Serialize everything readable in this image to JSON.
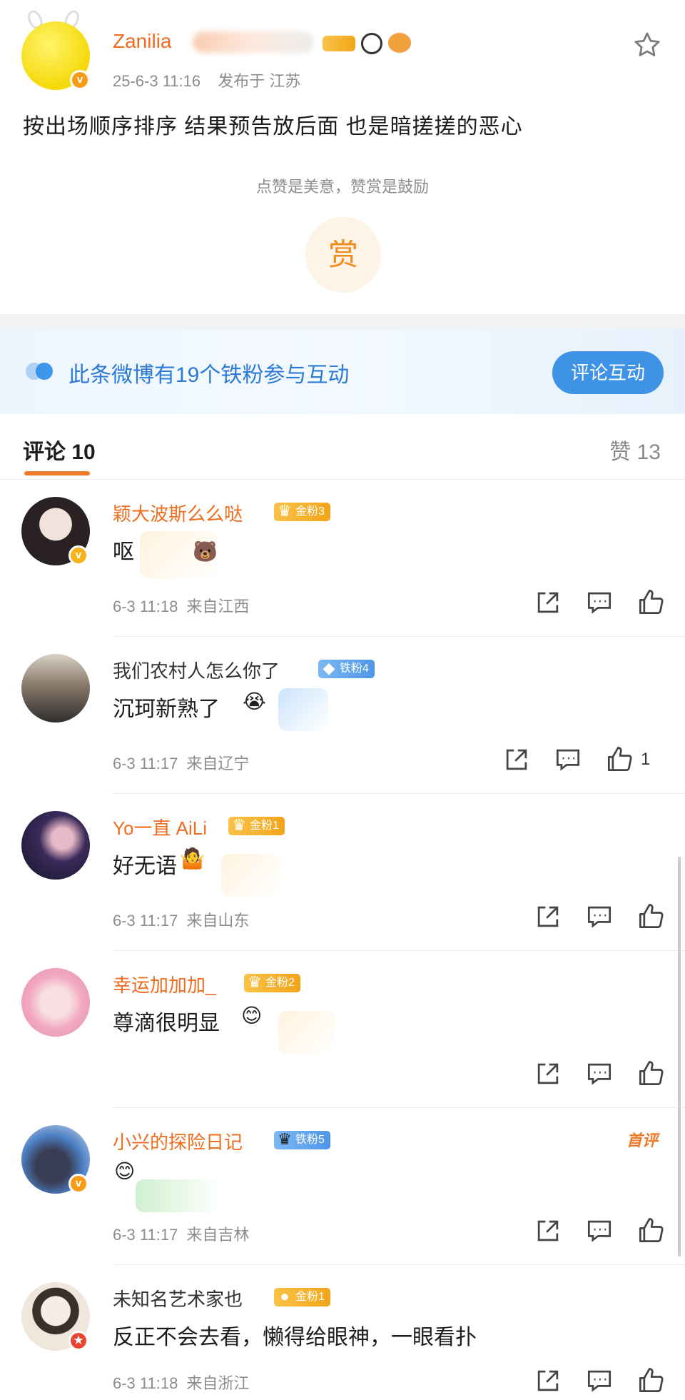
{
  "post": {
    "username": "Zanilia",
    "timestamp": "25-6-3 11:16",
    "location": "发布于 江苏",
    "text": "按出场顺序排序 结果预告放后面 也是暗搓搓的恶心",
    "reward_tip": "点赞是美意，赞赏是鼓励",
    "reward_label": "赏"
  },
  "banner": {
    "text": "此条微博有19个铁粉参与互动",
    "button_label": "评论互动"
  },
  "tabs": {
    "comments_label": "评论 10",
    "likes_label": "赞 13"
  },
  "comments": [
    {
      "name": "颖大波斯么么哒",
      "badge": "金粉3",
      "badge_type": "gold",
      "text": "呕",
      "time": "6-3 11:18",
      "location": "来自江西",
      "likes": ""
    },
    {
      "name": "我们农村人怎么你了",
      "badge": "铁粉4",
      "badge_type": "iron",
      "text": "沉珂新熟了",
      "time": "6-3 11:17",
      "location": "来自辽宁",
      "likes": "1"
    },
    {
      "name": "Yo一直 AiLi",
      "badge": "金粉1",
      "badge_type": "gold",
      "text": "好无语",
      "time": "6-3 11:17",
      "location": "来自山东",
      "likes": ""
    },
    {
      "name": "幸运加加加_",
      "badge": "金粉2",
      "badge_type": "gold",
      "text": "尊滴很明显",
      "time": "",
      "location": "",
      "likes": ""
    },
    {
      "name": "小兴的探险日记",
      "badge": "铁粉5",
      "badge_type": "iron",
      "text": "",
      "first_label": "首评",
      "time": "6-3 11:17",
      "location": "来自吉林",
      "likes": ""
    },
    {
      "name": "未知名艺术家也",
      "badge": "金粉1",
      "badge_type": "gold",
      "text": "反正不会去看，懒得给眼神，一眼看扑",
      "time": "6-3 11:18",
      "location": "来自浙江",
      "likes": ""
    }
  ],
  "icons": {
    "star": "star-icon",
    "share": "share-icon",
    "comment": "comment-icon",
    "like": "thumbs-up-icon"
  },
  "colors": {
    "accent_orange": "#f06c1f",
    "banner_blue": "#2c7bd7",
    "button_blue": "#3e93e6",
    "gold_badge": "#f2a419",
    "iron_badge": "#4f96e8"
  }
}
